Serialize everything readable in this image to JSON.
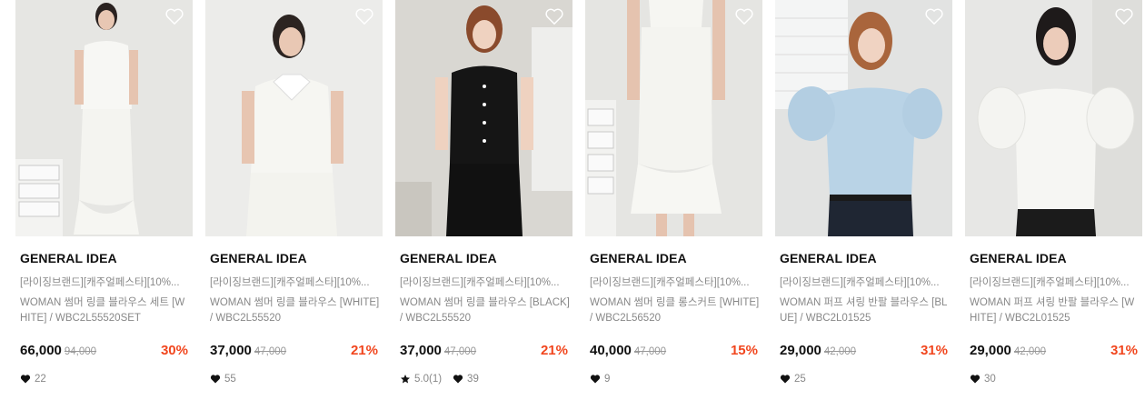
{
  "products": [
    {
      "brand": "GENERAL IDEA",
      "tagline": "[라이징브랜드][캐주얼페스타][10%...",
      "name": "WOMAN 썸머 링클 블라우스 세트 [WHITE] / WBC2L55520SET",
      "price": "66,000",
      "original_price": "94,000",
      "discount": "30%",
      "rating": "",
      "likes": "22",
      "icon": "heart-icon"
    },
    {
      "brand": "GENERAL IDEA",
      "tagline": "[라이징브랜드][캐주얼페스타][10%...",
      "name": "WOMAN 썸머 링클 블라우스 [WHITE] / WBC2L55520",
      "price": "37,000",
      "original_price": "47,000",
      "discount": "21%",
      "rating": "",
      "likes": "55",
      "icon": "heart-icon"
    },
    {
      "brand": "GENERAL IDEA",
      "tagline": "[라이징브랜드][캐주얼페스타][10%...",
      "name": "WOMAN 썸머 링클 블라우스 [BLACK] / WBC2L55520",
      "price": "37,000",
      "original_price": "47,000",
      "discount": "21%",
      "rating": "5.0(1)",
      "likes": "39",
      "icon": "heart-icon"
    },
    {
      "brand": "GENERAL IDEA",
      "tagline": "[라이징브랜드][캐주얼페스타][10%...",
      "name": "WOMAN 썸머 링클 롱스커트 [WHITE] / WBC2L56520",
      "price": "40,000",
      "original_price": "47,000",
      "discount": "15%",
      "rating": "",
      "likes": "9",
      "icon": "heart-icon"
    },
    {
      "brand": "GENERAL IDEA",
      "tagline": "[라이징브랜드][캐주얼페스타][10%...",
      "name": "WOMAN 퍼프 셔링 반팔 블라우스 [BLUE] / WBC2L01525",
      "price": "29,000",
      "original_price": "42,000",
      "discount": "31%",
      "rating": "",
      "likes": "25",
      "icon": "heart-icon"
    },
    {
      "brand": "GENERAL IDEA",
      "tagline": "[라이징브랜드][캐주얼페스타][10%...",
      "name": "WOMAN 퍼프 셔링 반팔 블라우스 [WHITE] / WBC2L01525",
      "price": "29,000",
      "original_price": "42,000",
      "discount": "31%",
      "rating": "",
      "likes": "30",
      "icon": "heart-icon"
    }
  ],
  "colors": {
    "discount": "#f1461e",
    "muted": "#888888",
    "brand": "#111111"
  }
}
